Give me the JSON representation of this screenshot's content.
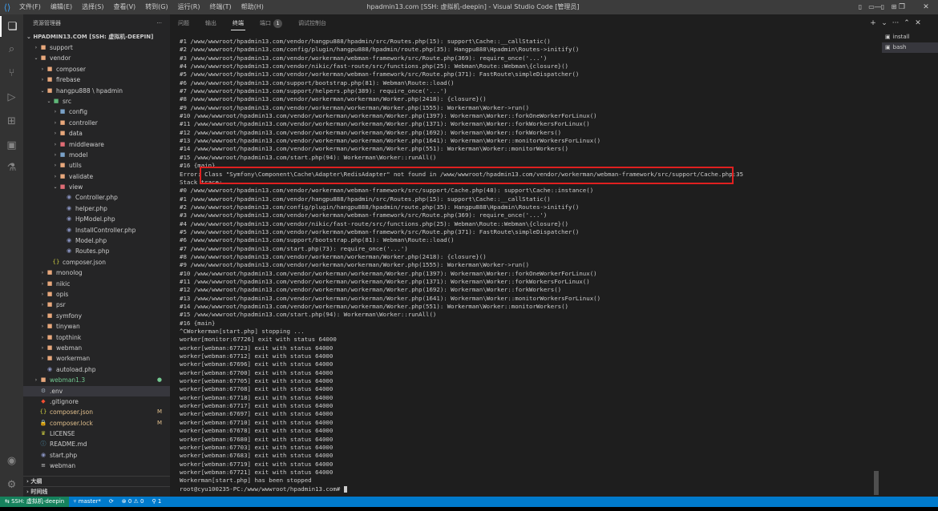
{
  "titlebar": {
    "menu": [
      "文件(F)",
      "编辑(E)",
      "选择(S)",
      "查看(V)",
      "转到(G)",
      "运行(R)",
      "终端(T)",
      "帮助(H)"
    ],
    "title": "hpadmin13.com [SSH: 虚拟机-deepin] - Visual Studio Code [管理员]"
  },
  "sidebar": {
    "header": "资源管理器",
    "more": "···",
    "root": "HPADMIN13.COM [SSH: 虚拟机-DEEPIN]",
    "items": [
      {
        "label": "support",
        "indent": 1,
        "type": "folder",
        "open": false,
        "color": "#e8a87c"
      },
      {
        "label": "vendor",
        "indent": 1,
        "type": "folder",
        "open": true,
        "color": "#e8a87c"
      },
      {
        "label": "composer",
        "indent": 2,
        "type": "folder",
        "open": false,
        "color": "#e8a87c"
      },
      {
        "label": "firebase",
        "indent": 2,
        "type": "folder",
        "open": false,
        "color": "#e8a87c"
      },
      {
        "label": "hangpu888 \\ hpadmin",
        "indent": 2,
        "type": "folder",
        "open": true,
        "color": "#e8a87c"
      },
      {
        "label": "src",
        "indent": 3,
        "type": "folder",
        "open": true,
        "color": "#5fb878"
      },
      {
        "label": "config",
        "indent": 4,
        "type": "folder",
        "open": false,
        "color": "#7aa2c9"
      },
      {
        "label": "controller",
        "indent": 4,
        "type": "folder",
        "open": false,
        "color": "#e8a87c"
      },
      {
        "label": "data",
        "indent": 4,
        "type": "folder",
        "open": false,
        "color": "#e8a87c"
      },
      {
        "label": "middleware",
        "indent": 4,
        "type": "folder",
        "open": false,
        "color": "#e06c75"
      },
      {
        "label": "model",
        "indent": 4,
        "type": "folder",
        "open": false,
        "color": "#7aa2c9"
      },
      {
        "label": "utils",
        "indent": 4,
        "type": "folder",
        "open": false,
        "color": "#e8a87c"
      },
      {
        "label": "validate",
        "indent": 4,
        "type": "folder",
        "open": false,
        "color": "#e8a87c"
      },
      {
        "label": "view",
        "indent": 4,
        "type": "folder",
        "open": true,
        "color": "#e06c75"
      },
      {
        "label": "Controller.php",
        "indent": 5,
        "type": "php",
        "color": "#8892bf"
      },
      {
        "label": "helper.php",
        "indent": 5,
        "type": "php",
        "color": "#8892bf"
      },
      {
        "label": "HpModel.php",
        "indent": 5,
        "type": "php",
        "color": "#8892bf"
      },
      {
        "label": "InstallController.php",
        "indent": 5,
        "type": "php",
        "color": "#8892bf"
      },
      {
        "label": "Model.php",
        "indent": 5,
        "type": "php",
        "color": "#8892bf"
      },
      {
        "label": "Routes.php",
        "indent": 5,
        "type": "php",
        "color": "#8892bf"
      },
      {
        "label": "composer.json",
        "indent": 3,
        "type": "json",
        "color": "#cbcb41"
      },
      {
        "label": "monolog",
        "indent": 2,
        "type": "folder",
        "open": false,
        "color": "#e8a87c"
      },
      {
        "label": "nikic",
        "indent": 2,
        "type": "folder",
        "open": false,
        "color": "#e8a87c"
      },
      {
        "label": "opis",
        "indent": 2,
        "type": "folder",
        "open": false,
        "color": "#e8a87c"
      },
      {
        "label": "psr",
        "indent": 2,
        "type": "folder",
        "open": false,
        "color": "#e8a87c"
      },
      {
        "label": "symfony",
        "indent": 2,
        "type": "folder",
        "open": false,
        "color": "#e8a87c"
      },
      {
        "label": "tinywan",
        "indent": 2,
        "type": "folder",
        "open": false,
        "color": "#e8a87c"
      },
      {
        "label": "topthink",
        "indent": 2,
        "type": "folder",
        "open": false,
        "color": "#e8a87c"
      },
      {
        "label": "webman",
        "indent": 2,
        "type": "folder",
        "open": false,
        "color": "#e8a87c"
      },
      {
        "label": "workerman",
        "indent": 2,
        "type": "folder",
        "open": false,
        "color": "#e8a87c"
      },
      {
        "label": "autoload.php",
        "indent": 2,
        "type": "php",
        "color": "#8892bf"
      },
      {
        "label": "webman1.3",
        "indent": 1,
        "type": "folder",
        "open": false,
        "color": "#e8a87c",
        "badge": "●",
        "badge_color": "#73c991",
        "text_color": "#73c991"
      },
      {
        "label": ".env",
        "indent": 1,
        "type": "gear",
        "color": "#9aa5b1",
        "selected": true
      },
      {
        "label": ".gitignore",
        "indent": 1,
        "type": "git",
        "color": "#f14e32"
      },
      {
        "label": "composer.json",
        "indent": 1,
        "type": "json",
        "color": "#cbcb41",
        "badge": "M",
        "badge_color": "#e2c08d",
        "text_color": "#e2c08d"
      },
      {
        "label": "composer.lock",
        "indent": 1,
        "type": "lock",
        "color": "#cbcb41",
        "badge": "M",
        "badge_color": "#e2c08d",
        "text_color": "#e2c08d"
      },
      {
        "label": "LICENSE",
        "indent": 1,
        "type": "license",
        "color": "#cbcb41"
      },
      {
        "label": "README.md",
        "indent": 1,
        "type": "md",
        "color": "#519aba"
      },
      {
        "label": "start.php",
        "indent": 1,
        "type": "php",
        "color": "#8892bf"
      },
      {
        "label": "webman",
        "indent": 1,
        "type": "file",
        "color": "#cccccc"
      }
    ],
    "outline": "大纲",
    "timeline": "时间线"
  },
  "panel": {
    "tabs": [
      "问题",
      "输出",
      "终端",
      "端口",
      "调试控制台"
    ],
    "active_tab": 2,
    "ports_count": "1"
  },
  "terminal_list": [
    "install",
    "bash"
  ],
  "terminal": {
    "lines": [
      "#1 /www/wwwroot/hpadmin13.com/vendor/hangpu888/hpadmin/src/Routes.php(15): support\\Cache::__callStatic()",
      "#2 /www/wwwroot/hpadmin13.com/config/plugin/hangpu888/hpadmin/route.php(35): Hangpu888\\Hpadmin\\Routes->initify()",
      "#3 /www/wwwroot/hpadmin13.com/vendor/workerman/webman-framework/src/Route.php(369): require_once('...')",
      "#4 /www/wwwroot/hpadmin13.com/vendor/nikic/fast-route/src/functions.php(25): Webman\\Route::Webman\\{closure}()",
      "#5 /www/wwwroot/hpadmin13.com/vendor/workerman/webman-framework/src/Route.php(371): FastRoute\\simpleDispatcher()",
      "#6 /www/wwwroot/hpadmin13.com/support/bootstrap.php(81): Webman\\Route::load()",
      "#7 /www/wwwroot/hpadmin13.com/support/helpers.php(389): require_once('...')",
      "#8 /www/wwwroot/hpadmin13.com/vendor/workerman/workerman/Worker.php(2418): {closure}()",
      "#9 /www/wwwroot/hpadmin13.com/vendor/workerman/workerman/Worker.php(1555): Workerman\\Worker->run()",
      "#10 /www/wwwroot/hpadmin13.com/vendor/workerman/workerman/Worker.php(1397): Workerman\\Worker::forkOneWorkerForLinux()",
      "#11 /www/wwwroot/hpadmin13.com/vendor/workerman/workerman/Worker.php(1371): Workerman\\Worker::forkWorkersForLinux()",
      "#12 /www/wwwroot/hpadmin13.com/vendor/workerman/workerman/Worker.php(1692): Workerman\\Worker::forkWorkers()",
      "#13 /www/wwwroot/hpadmin13.com/vendor/workerman/workerman/Worker.php(1641): Workerman\\Worker::monitorWorkersForLinux()",
      "#14 /www/wwwroot/hpadmin13.com/vendor/workerman/workerman/Worker.php(551): Workerman\\Worker::monitorWorkers()",
      "#15 /www/wwwroot/hpadmin13.com/start.php(94): Workerman\\Worker::runAll()",
      "#16 {main}",
      "Error: Class \"Symfony\\Component\\Cache\\Adapter\\RedisAdapter\" not found in /www/wwwroot/hpadmin13.com/vendor/workerman/webman-framework/src/support/Cache.php:35",
      "Stack trace:",
      "#0 /www/wwwroot/hpadmin13.com/vendor/workerman/webman-framework/src/support/Cache.php(48): support\\Cache::instance()",
      "#1 /www/wwwroot/hpadmin13.com/vendor/hangpu888/hpadmin/src/Routes.php(15): support\\Cache::__callStatic()",
      "#2 /www/wwwroot/hpadmin13.com/config/plugin/hangpu888/hpadmin/route.php(35): Hangpu888\\Hpadmin\\Routes->initify()",
      "#3 /www/wwwroot/hpadmin13.com/vendor/workerman/webman-framework/src/Route.php(369): require_once('...')",
      "#4 /www/wwwroot/hpadmin13.com/vendor/nikic/fast-route/src/functions.php(25): Webman\\Route::Webman\\{closure}()",
      "#5 /www/wwwroot/hpadmin13.com/vendor/workerman/webman-framework/src/Route.php(371): FastRoute\\simpleDispatcher()",
      "#6 /www/wwwroot/hpadmin13.com/support/bootstrap.php(81): Webman\\Route::load()",
      "#7 /www/wwwroot/hpadmin13.com/start.php(73): require_once('...')",
      "#8 /www/wwwroot/hpadmin13.com/vendor/workerman/workerman/Worker.php(2418): {closure}()",
      "#9 /www/wwwroot/hpadmin13.com/vendor/workerman/workerman/Worker.php(1555): Workerman\\Worker->run()",
      "#10 /www/wwwroot/hpadmin13.com/vendor/workerman/workerman/Worker.php(1397): Workerman\\Worker::forkOneWorkerForLinux()",
      "#11 /www/wwwroot/hpadmin13.com/vendor/workerman/workerman/Worker.php(1371): Workerman\\Worker::forkWorkersForLinux()",
      "#12 /www/wwwroot/hpadmin13.com/vendor/workerman/workerman/Worker.php(1692): Workerman\\Worker::forkWorkers()",
      "#13 /www/wwwroot/hpadmin13.com/vendor/workerman/workerman/Worker.php(1641): Workerman\\Worker::monitorWorkersForLinux()",
      "#14 /www/wwwroot/hpadmin13.com/vendor/workerman/workerman/Worker.php(551): Workerman\\Worker::monitorWorkers()",
      "#15 /www/wwwroot/hpadmin13.com/start.php(94): Workerman\\Worker::runAll()",
      "#16 {main}",
      "^CWorkerman[start.php] stopping ...",
      "worker[monitor:67726] exit with status 64000",
      "worker[webman:67723] exit with status 64000",
      "worker[webman:67712] exit with status 64000",
      "worker[webman:67696] exit with status 64000",
      "worker[webman:67700] exit with status 64000",
      "worker[webman:67705] exit with status 64000",
      "worker[webman:67708] exit with status 64000",
      "worker[webman:67718] exit with status 64000",
      "worker[webman:67717] exit with status 64000",
      "worker[webman:67697] exit with status 64000",
      "worker[webman:67710] exit with status 64000",
      "worker[webman:67678] exit with status 64000",
      "worker[webman:67680] exit with status 64000",
      "worker[webman:67703] exit with status 64000",
      "worker[webman:67683] exit with status 64000",
      "worker[webman:67719] exit with status 64000",
      "worker[webman:67721] exit with status 64000",
      "Workerman[start.php] has been stopped"
    ],
    "prompt": "root@cyu100235-PC:/www/wwwroot/hpadmin13.com# "
  },
  "statusbar": {
    "remote": "SSH: 虚拟机-deepin",
    "branch": "master*",
    "sync": "⟳",
    "problems": "⊗ 0 ⚠ 0",
    "ports": "1"
  }
}
